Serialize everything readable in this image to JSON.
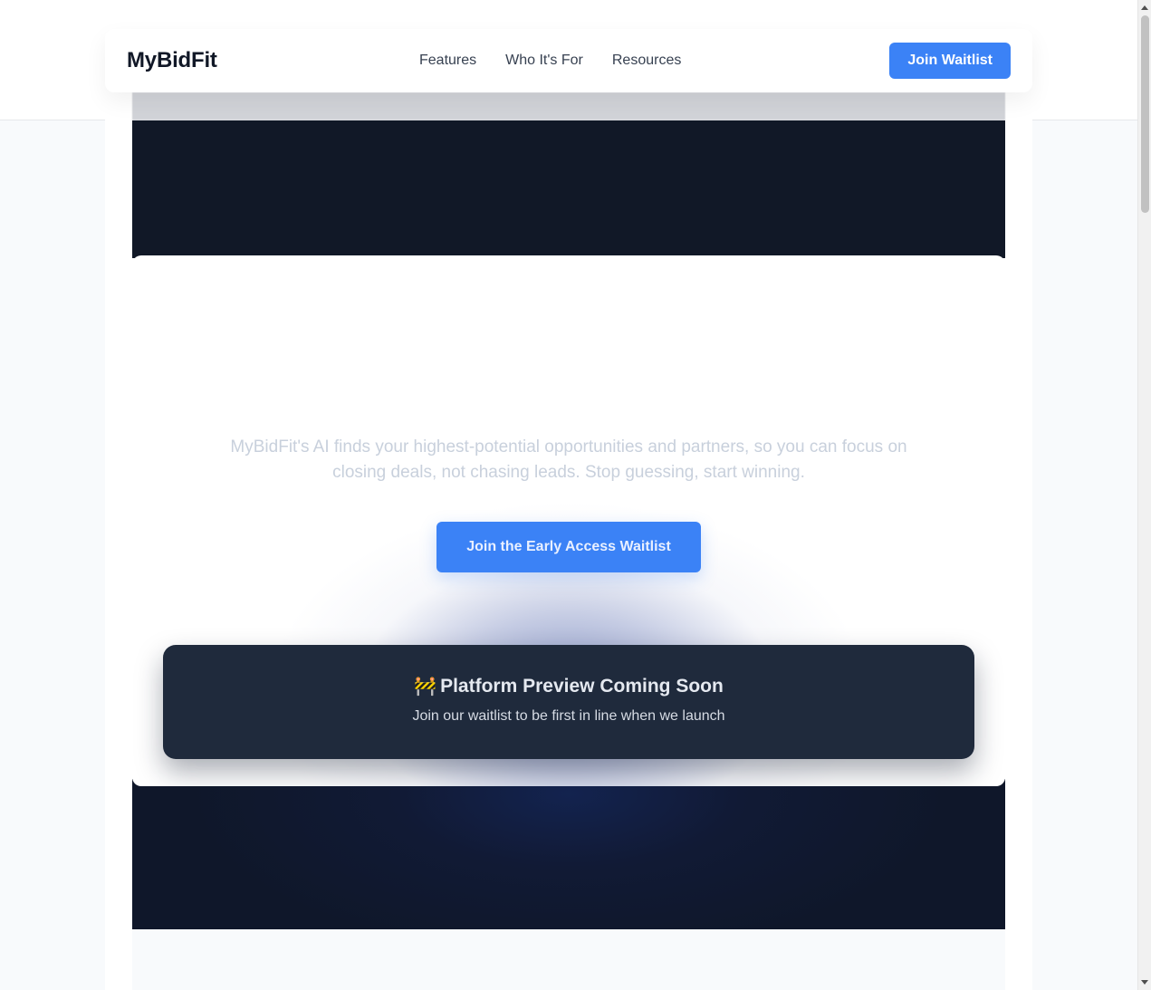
{
  "nav": {
    "brand": "MyBidFit",
    "links": [
      "Features",
      "Who It's For",
      "Resources"
    ],
    "cta_label": "Join Waitlist"
  },
  "hero": {
    "subtitle": "MyBidFit's AI finds your highest-potential opportunities and partners, so you can focus on closing deals, not chasing leads. Stop guessing, start winning.",
    "cta_label": "Join the Early Access Waitlist"
  },
  "preview": {
    "icon": "🚧",
    "title": "Platform Preview Coming Soon",
    "subtitle": "Join our waitlist to be first in line when we launch"
  },
  "colors": {
    "accent": "#3b82f6",
    "dark": "#111827",
    "preview_bg": "#1f2a3c"
  }
}
